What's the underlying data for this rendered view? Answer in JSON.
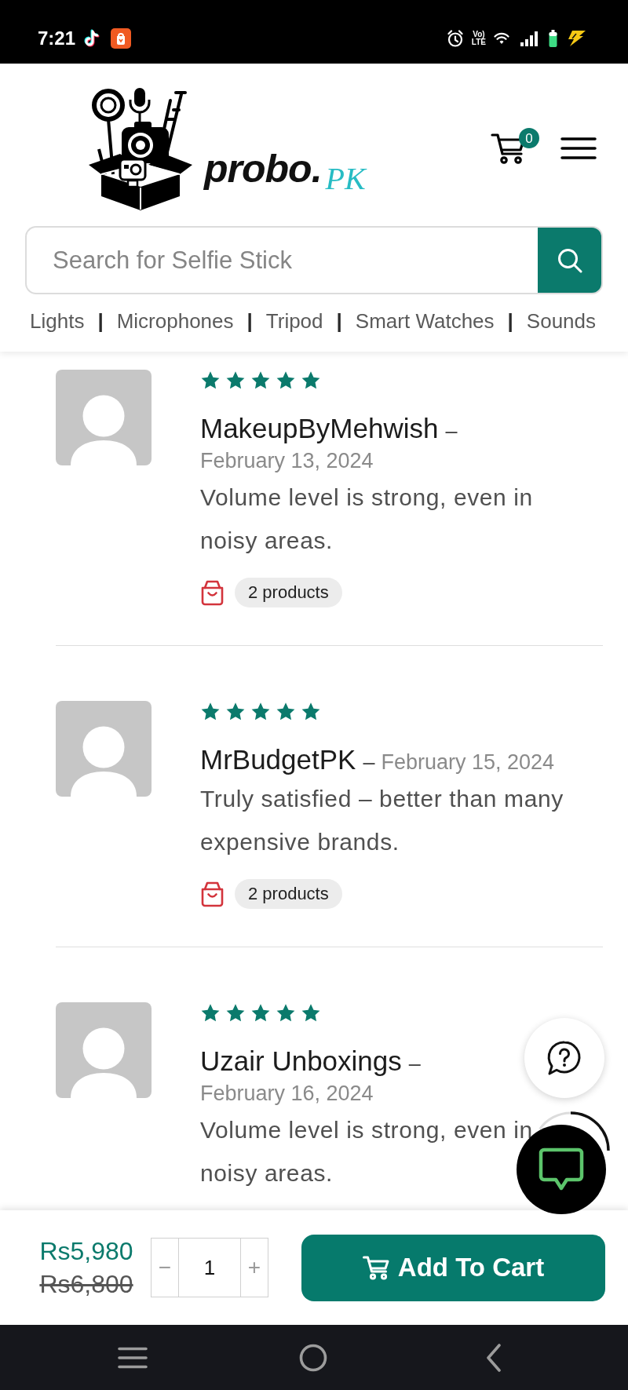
{
  "status_bar": {
    "time": "7:21",
    "volte": [
      "Vo)",
      "LTE"
    ]
  },
  "header": {
    "logo": {
      "name": "probo.",
      "suffix": "PK"
    },
    "cart_count": "0",
    "search": {
      "placeholder": "Search for Selfie Stick"
    },
    "category_links": [
      {
        "kind": "link",
        "text": "Lights"
      },
      {
        "kind": "separator",
        "text": "|"
      },
      {
        "kind": "link",
        "text": "Microphones"
      },
      {
        "kind": "separator",
        "text": "|"
      },
      {
        "kind": "link",
        "text": "Tripod"
      },
      {
        "kind": "separator",
        "text": "|"
      },
      {
        "kind": "link",
        "text": "Smart Watches"
      },
      {
        "kind": "separator",
        "text": "|"
      },
      {
        "kind": "link",
        "text": "Sounds"
      }
    ]
  },
  "reviews": [
    {
      "stars": 5,
      "author": "MakeupByMehwish",
      "dash": "–",
      "date": "February 13, 2024",
      "text": "Volume level is strong, even in noisy areas.",
      "products": "2 products"
    },
    {
      "stars": 5,
      "author": "MrBudgetPK",
      "dash": "–",
      "date": "February 15, 2024",
      "text": "Truly satisfied – better than many expensive brands.",
      "products": "2 products"
    },
    {
      "stars": 5,
      "author": "Uzair Unboxings",
      "dash": "–",
      "date": "February 16, 2024",
      "text": "Volume level is strong, even in noisy areas."
    }
  ],
  "purchase_bar": {
    "price": "Rs5,980",
    "old_price": "Rs6,800",
    "quantity": {
      "decrement": "−",
      "value": "1",
      "increment": "+"
    },
    "add_button": "Add To Cart"
  }
}
